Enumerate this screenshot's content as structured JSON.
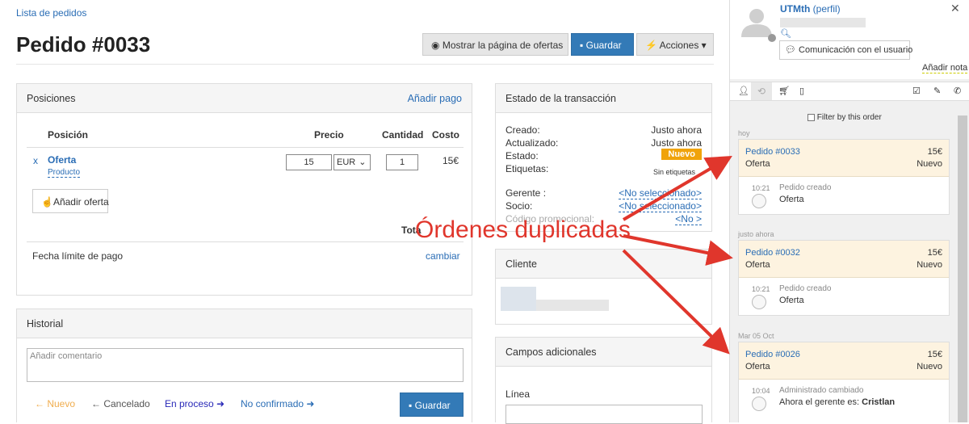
{
  "header": {
    "breadcrumb": "Lista de pedidos",
    "title": "Pedido #0033",
    "btn_show": "Mostrar la página de ofertas",
    "btn_save": "Guardar",
    "btn_actions": "Acciones"
  },
  "positions": {
    "title": "Posiciones",
    "add_payment": "Añadir pago",
    "col_position": "Posición",
    "col_price": "Precio",
    "col_qty": "Cantidad",
    "col_cost": "Costo",
    "row": {
      "remove": "x",
      "name": "Oferta",
      "type": "Producto",
      "price": "15",
      "currency": "EUR",
      "qty": "1",
      "cost": "15€"
    },
    "add_offer": "Añadir oferta",
    "total_partial": "Tota",
    "due_label": "Fecha límite de pago",
    "change": "cambiar"
  },
  "history": {
    "title": "Historial",
    "comment_placeholder": "Añadir comentario",
    "status_new": "Nuevo",
    "status_cancel": "Cancelado",
    "status_process": "En proceso",
    "status_unconfirmed": "No confirmado",
    "save": "Guardar"
  },
  "transaction": {
    "title": "Estado de la transacción",
    "created_label": "Creado:",
    "created_val": "Justo ahora",
    "updated_label": "Actualizado:",
    "updated_val": "Justo ahora",
    "status_label": "Estado:",
    "status_val": "Nuevo",
    "tags_label": "Etiquetas:",
    "tags_val": "Sin etiquetas",
    "manager_label": "Gerente :",
    "manager_val": "<No seleccionado>",
    "partner_label": "Socio:",
    "partner_val": "<No seleccionado>",
    "promo_label": "Código promocional:",
    "promo_val": "<No >"
  },
  "client": {
    "title": "Cliente"
  },
  "extra": {
    "title": "Campos adicionales",
    "line_label": "Línea"
  },
  "annotation": {
    "text": "Órdenes duplicadas",
    "color": "#e0362c"
  },
  "sidebar": {
    "user_name": "UTMth",
    "profile_link": "(perfil)",
    "comm_button": "Comunicación con el usuario",
    "add_note": "Añadir nota",
    "filter_label": "Filter by this order",
    "tabs": [
      "user-icon",
      "history-icon",
      "cart-icon",
      "mobile-icon",
      "check-icon",
      "pencil-icon",
      "phone-icon"
    ],
    "groups": [
      {
        "date": "hoy",
        "order": "Pedido #0033",
        "amount": "15€",
        "item": "Oferta",
        "status": "Nuevo",
        "time": "10:21",
        "event": "Pedido creado",
        "detail": "Oferta"
      },
      {
        "date": "justo ahora",
        "order": "Pedido #0032",
        "amount": "15€",
        "item": "Oferta",
        "status": "Nuevo",
        "time": "10:21",
        "event": "Pedido creado",
        "detail": "Oferta"
      },
      {
        "date": "Mar 05 Oct",
        "order": "Pedido #0026",
        "amount": "15€",
        "item": "Oferta",
        "status": "Nuevo",
        "time": "10:04",
        "event": "Administrado cambiado",
        "detail": "Ahora el gerente es:",
        "detail_bold": "Cristlan"
      }
    ]
  }
}
